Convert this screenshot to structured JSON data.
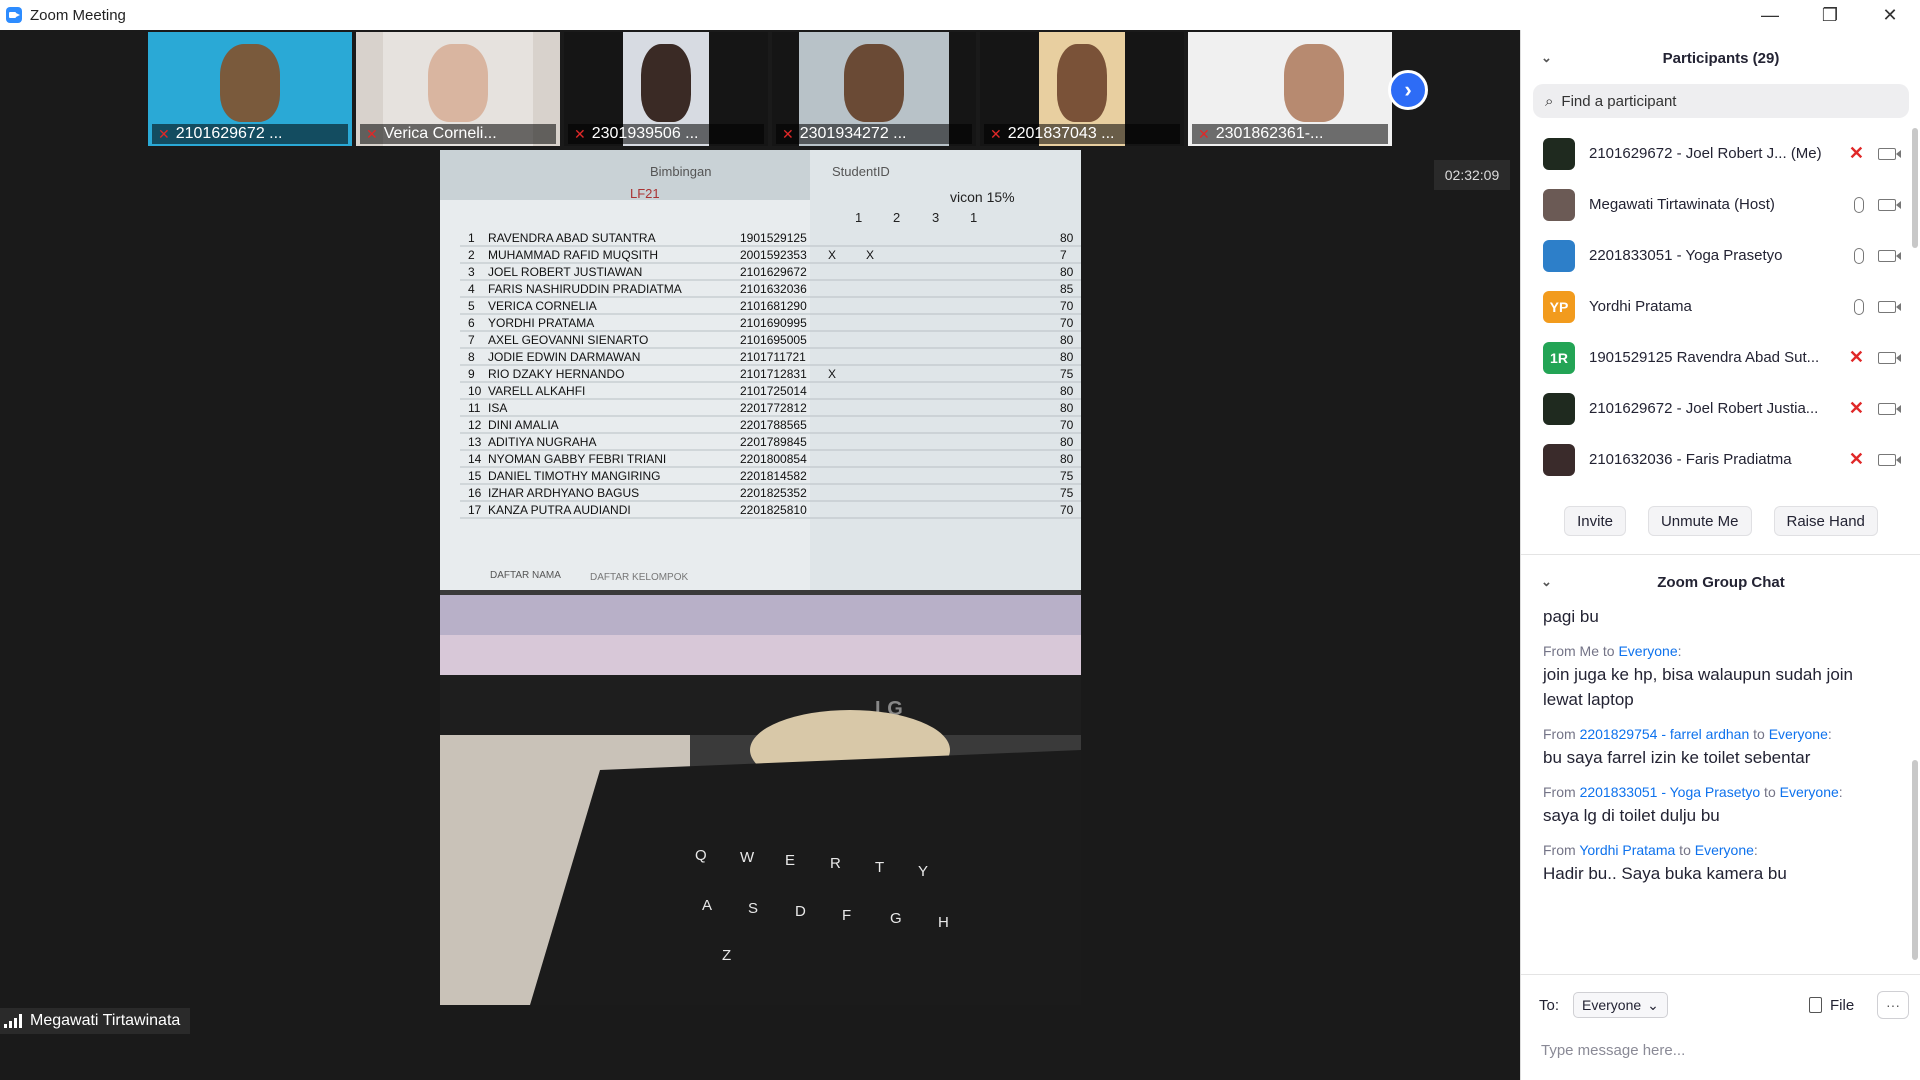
{
  "window": {
    "title": "Zoom Meeting",
    "controls": {
      "minimize": "—",
      "restore": "❐",
      "close": "✕"
    }
  },
  "video": {
    "thumbnails": [
      {
        "name": "2101629672 ...",
        "muted": true
      },
      {
        "name": "Verica Corneli...",
        "muted": true
      },
      {
        "name": "2301939506 ...",
        "muted": true
      },
      {
        "name": "2301934272 ...",
        "muted": true
      },
      {
        "name": "2201837043 ...",
        "muted": true
      },
      {
        "name": "2301862361-...",
        "muted": true
      }
    ],
    "next_icon": "chevron-right-icon",
    "timer": "02:32:09",
    "speaker_name": "Megawati Tirtawinata",
    "shared_sheet": {
      "header_left": "Bimbingan",
      "header_id": "StudentID",
      "class": "LF21",
      "vicon": "vicon 15%",
      "cols": [
        "1",
        "2",
        "3",
        "1"
      ],
      "rows": [
        {
          "no": "1",
          "name": "RAVENDRA ABAD SUTANTRA",
          "id": "1901529125",
          "c1": "",
          "c2": "",
          "score": "80"
        },
        {
          "no": "2",
          "name": "MUHAMMAD RAFID MUQSITH",
          "id": "2001592353",
          "c1": "X",
          "c2": "X",
          "score": "7"
        },
        {
          "no": "3",
          "name": "JOEL ROBERT JUSTIAWAN",
          "id": "2101629672",
          "c1": "",
          "c2": "",
          "score": "80"
        },
        {
          "no": "4",
          "name": "FARIS NASHIRUDDIN PRADIATMA",
          "id": "2101632036",
          "c1": "",
          "c2": "",
          "score": "85"
        },
        {
          "no": "5",
          "name": "VERICA CORNELIA",
          "id": "2101681290",
          "c1": "",
          "c2": "",
          "score": "70"
        },
        {
          "no": "6",
          "name": "YORDHI PRATAMA",
          "id": "2101690995",
          "c1": "",
          "c2": "",
          "score": "70"
        },
        {
          "no": "7",
          "name": "AXEL GEOVANNI SIENARTO",
          "id": "2101695005",
          "c1": "",
          "c2": "",
          "score": "80"
        },
        {
          "no": "8",
          "name": "JODIE EDWIN DARMAWAN",
          "id": "2101711721",
          "c1": "",
          "c2": "",
          "score": "80"
        },
        {
          "no": "9",
          "name": "RIO DZAKY HERNANDO",
          "id": "2101712831",
          "c1": "X",
          "c2": "",
          "score": "75"
        },
        {
          "no": "10",
          "name": "VARELL ALKAHFI",
          "id": "2101725014",
          "c1": "",
          "c2": "",
          "score": "80"
        },
        {
          "no": "11",
          "name": "ISA",
          "id": "2201772812",
          "c1": "",
          "c2": "",
          "score": "80"
        },
        {
          "no": "12",
          "name": "DINI AMALIA",
          "id": "2201788565",
          "c1": "",
          "c2": "",
          "score": "70"
        },
        {
          "no": "13",
          "name": "ADITIYA NUGRAHA",
          "id": "2201789845",
          "c1": "",
          "c2": "",
          "score": "80"
        },
        {
          "no": "14",
          "name": "NYOMAN GABBY FEBRI TRIANI",
          "id": "2201800854",
          "c1": "",
          "c2": "",
          "score": "80"
        },
        {
          "no": "15",
          "name": "DANIEL TIMOTHY MANGIRING",
          "id": "2201814582",
          "c1": "",
          "c2": "",
          "score": "75"
        },
        {
          "no": "16",
          "name": "IZHAR ARDHYANO BAGUS",
          "id": "2201825352",
          "c1": "",
          "c2": "",
          "score": "75"
        },
        {
          "no": "17",
          "name": "KANZA PUTRA AUDIANDI",
          "id": "2201825810",
          "c1": "",
          "c2": "",
          "score": "70"
        }
      ],
      "sheet_tabs": [
        "DAFTAR NAMA",
        "DAFTAR KELOMPOK"
      ],
      "monitor_brand": "LG",
      "keyboard_keys": [
        "Q",
        "W",
        "E",
        "R",
        "T",
        "Y",
        "A",
        "S",
        "D",
        "F",
        "G",
        "H",
        "Z"
      ]
    }
  },
  "participants": {
    "title": "Participants (29)",
    "search_placeholder": "Find a participant",
    "items": [
      {
        "name": "2101629672 - Joel Robert J...",
        "tag": "(Me)",
        "avatar": "",
        "avatar_color": "#1f2a1f",
        "mic_muted": true
      },
      {
        "name": "Megawati Tirtawinata (Host)",
        "tag": "",
        "avatar": "",
        "avatar_color": "#6b5a55",
        "mic_muted": false
      },
      {
        "name": "2201833051 - Yoga Prasetyo",
        "tag": "",
        "avatar": "",
        "avatar_color": "#2d7fc9",
        "mic_muted": false
      },
      {
        "name": "Yordhi Pratama",
        "tag": "",
        "avatar": "YP",
        "avatar_color": "#f29b1d",
        "mic_muted": false
      },
      {
        "name": "1901529125 Ravendra Abad Sut...",
        "tag": "",
        "avatar": "1R",
        "avatar_color": "#23a455",
        "mic_muted": true
      },
      {
        "name": "2101629672 - Joel Robert Justia...",
        "tag": "",
        "avatar": "",
        "avatar_color": "#1f2a1f",
        "mic_muted": true
      },
      {
        "name": "2101632036 - Faris Pradiatma",
        "tag": "",
        "avatar": "",
        "avatar_color": "#3a2b2b",
        "mic_muted": true
      }
    ],
    "buttons": {
      "invite": "Invite",
      "unmute": "Unmute Me",
      "raise_hand": "Raise Hand"
    }
  },
  "chat": {
    "title": "Zoom Group Chat",
    "messages": [
      {
        "from_prefix": "",
        "from": "",
        "to_prefix": "",
        "to": "",
        "to_suffix": "",
        "body": "pagi bu"
      },
      {
        "from_prefix": "From Me to ",
        "from": "",
        "to_prefix": "",
        "to": "Everyone",
        "to_suffix": ":",
        "body": "join juga ke hp, bisa walaupun sudah join lewat laptop"
      },
      {
        "from_prefix": "From ",
        "from": "2201829754 - farrel ardhan",
        "to_prefix": " to ",
        "to": "Everyone",
        "to_suffix": ":",
        "body": "bu saya farrel izin ke toilet sebentar"
      },
      {
        "from_prefix": "From ",
        "from": "2201833051 - Yoga Prasetyo",
        "to_prefix": " to ",
        "to": "Everyone",
        "to_suffix": ":",
        "body": "saya lg di toilet dulju bu"
      },
      {
        "from_prefix": "From ",
        "from": "Yordhi Pratama",
        "to_prefix": " to ",
        "to": "Everyone",
        "to_suffix": ":",
        "body": "Hadir bu.. Saya buka kamera bu"
      }
    ],
    "to_label": "To:",
    "to_value": "Everyone",
    "file_label": "File",
    "more_label": "···",
    "input_placeholder": "Type message here..."
  },
  "colors": {
    "accent": "#0e72ed",
    "muted_red": "#e02828",
    "panel_bg": "#ffffff",
    "video_bg": "#1a1a1a"
  }
}
